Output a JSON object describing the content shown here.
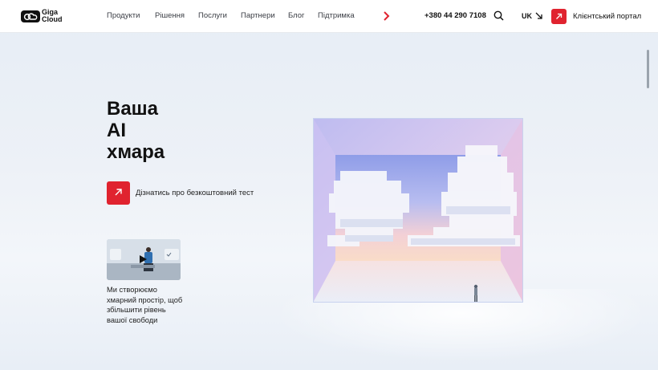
{
  "header": {
    "logo_line1": "Giga",
    "logo_line2": "Cloud",
    "nav": [
      "Продукти",
      "Рішення",
      "Послуги",
      "Партнери",
      "Блог",
      "Підтримка"
    ],
    "phone": "+380 44 290 7108",
    "language": "UK",
    "portal_label": "Клієнтський портал"
  },
  "hero": {
    "title_line1": "Ваша",
    "title_line2": "AI",
    "title_line3": "хмара",
    "cta_label": "Дізнатись про безкоштовний тест",
    "video_caption": "Ми створюємо хмарний простір, щоб збільшити рівень вашої свободи"
  },
  "colors": {
    "accent": "#e0232f",
    "text": "#111111",
    "header_bg": "#ffffff"
  },
  "icons": {
    "nav_more": "chevron-right-icon",
    "search": "search-icon",
    "lang": "arrow-down-right-icon",
    "portal": "arrow-up-right-icon",
    "cta": "arrow-up-right-icon",
    "video": "play-icon"
  }
}
